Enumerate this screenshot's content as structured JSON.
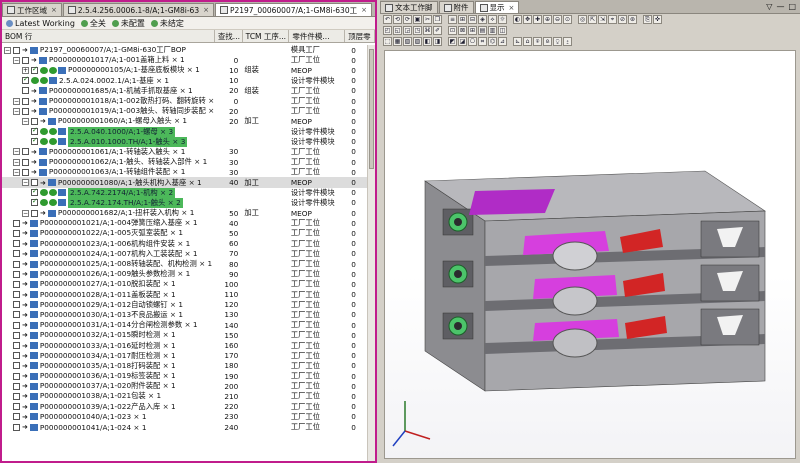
{
  "left_tabs": [
    {
      "label": "工作区域",
      "active": false
    },
    {
      "label": "2.5.4.256.0006.1-8/A;1-GM8i-63",
      "active": false
    },
    {
      "label": "P2197_00060007/A;1-GM8i-630工",
      "active": true
    }
  ],
  "filters": [
    {
      "label": "Latest Working",
      "color": "#6b8fc4"
    },
    {
      "label": "全关",
      "color": "#4f9e4f"
    },
    {
      "label": "未配置",
      "color": "#4f9e4f"
    },
    {
      "label": "未结定",
      "color": "#4f9e4f"
    }
  ],
  "columns": [
    "BOM 行",
    "查找...",
    "TCM 工序...",
    "零件件模...",
    "顶层零"
  ],
  "rows": [
    {
      "depth": 0,
      "exp": "-",
      "name": "P2197_00060007/A;1-GM8i-630工厂BOP",
      "find": "",
      "tcm": "",
      "part": "模具工厂",
      "top": "0",
      "sel": false,
      "hl": false,
      "chk": false
    },
    {
      "depth": 1,
      "exp": "-",
      "name": "P000000001017/A;1-001盖箱上料 × 1",
      "find": "0",
      "tcm": "",
      "part": "工厂工位",
      "top": "0",
      "sel": false,
      "hl": false,
      "chk": false
    },
    {
      "depth": 2,
      "exp": "+",
      "name": "P00000000105/A;1-基座底板模块 × 1",
      "find": "10",
      "tcm": "组装",
      "part": "MEOP",
      "top": "0",
      "sel": false,
      "hl": false,
      "chk": true
    },
    {
      "depth": 2,
      "exp": "",
      "name": "2.5.A.024.0002.1/A;1-基座 × 1",
      "find": "10",
      "tcm": "",
      "part": "设计零件模块",
      "top": "0",
      "sel": false,
      "hl": false,
      "chk": true
    },
    {
      "depth": 2,
      "exp": "",
      "name": "P000000001685/A;1-机械手抓取基座 × 1",
      "find": "20",
      "tcm": "组装",
      "part": "工厂工位",
      "top": "0",
      "sel": false,
      "hl": false,
      "chk": false
    },
    {
      "depth": 1,
      "exp": "-",
      "name": "P000000001018/A;1-002散热打码、翻转旋转 × 1",
      "find": "0",
      "tcm": "",
      "part": "工厂工位",
      "top": "0",
      "sel": false,
      "hl": false,
      "chk": false
    },
    {
      "depth": 1,
      "exp": "-",
      "name": "P000000001019/A;1-003触头、转轴同步装配 × 1",
      "find": "20",
      "tcm": "",
      "part": "工厂工位",
      "top": "0",
      "sel": false,
      "hl": false,
      "chk": false
    },
    {
      "depth": 2,
      "exp": "-",
      "name": "P000000001060/A;1-螺母入触头 × 1",
      "find": "20",
      "tcm": "加工",
      "part": "MEOP",
      "top": "0",
      "sel": false,
      "hl": false,
      "chk": false
    },
    {
      "depth": 3,
      "exp": "",
      "name": "2.5.A.040.1000/A;1-螺母 × 3",
      "find": "",
      "tcm": "",
      "part": "设计零件模块",
      "top": "0",
      "sel": false,
      "hl": true,
      "chk": true
    },
    {
      "depth": 3,
      "exp": "",
      "name": "2.5.A.010.1000.TH/A;1-触头 × 3",
      "find": "",
      "tcm": "",
      "part": "设计零件模块",
      "top": "0",
      "sel": false,
      "hl": true,
      "chk": true
    },
    {
      "depth": 1,
      "exp": "-",
      "name": "P000000001061/A;1-转轴装入触头 × 1",
      "find": "30",
      "tcm": "",
      "part": "工厂工位",
      "top": "0",
      "sel": false,
      "hl": false,
      "chk": false
    },
    {
      "depth": 1,
      "exp": "-",
      "name": "P000000001062/A;1-触头、转轴装入部件 × 1",
      "find": "30",
      "tcm": "",
      "part": "工厂工位",
      "top": "0",
      "sel": false,
      "hl": false,
      "chk": false
    },
    {
      "depth": 1,
      "exp": "-",
      "name": "P000000001063/A;1-转轴组件装配 × 1",
      "find": "30",
      "tcm": "",
      "part": "工厂工位",
      "top": "0",
      "sel": false,
      "hl": false,
      "chk": false
    },
    {
      "depth": 2,
      "exp": "-",
      "name": "P000000001080/A;1-触头机构入基座 × 1",
      "find": "40",
      "tcm": "加工",
      "part": "MEOP",
      "top": "0",
      "sel": true,
      "hl": false,
      "chk": false
    },
    {
      "depth": 3,
      "exp": "",
      "name": "2.5.A.742.2174/A;1-机构 × 2",
      "find": "",
      "tcm": "",
      "part": "设计零件模块",
      "top": "0",
      "sel": false,
      "hl": true,
      "chk": true
    },
    {
      "depth": 3,
      "exp": "",
      "name": "2.5.A.742.174.TH/A;1-触头 × 2",
      "find": "",
      "tcm": "",
      "part": "设计零件模块",
      "top": "0",
      "sel": false,
      "hl": true,
      "chk": true
    },
    {
      "depth": 2,
      "exp": "-",
      "name": "P000000001682/A;1-扭杆装入机构 × 1",
      "find": "50",
      "tcm": "加工",
      "part": "MEOP",
      "top": "0",
      "sel": false,
      "hl": false,
      "chk": false
    },
    {
      "depth": 1,
      "exp": "",
      "name": "P000000001021/A;1-004弹簧压缩入基座 × 1",
      "find": "40",
      "tcm": "",
      "part": "工厂工位",
      "top": "0",
      "sel": false,
      "hl": false,
      "chk": false
    },
    {
      "depth": 1,
      "exp": "",
      "name": "P000000001022/A;1-005灭弧室装配 × 1",
      "find": "50",
      "tcm": "",
      "part": "工厂工位",
      "top": "0",
      "sel": false,
      "hl": false,
      "chk": false
    },
    {
      "depth": 1,
      "exp": "",
      "name": "P000000001023/A;1-006机构组件安装 × 1",
      "find": "60",
      "tcm": "",
      "part": "工厂工位",
      "top": "0",
      "sel": false,
      "hl": false,
      "chk": false
    },
    {
      "depth": 1,
      "exp": "",
      "name": "P000000001024/A;1-007机构入工装装配 × 1",
      "find": "70",
      "tcm": "",
      "part": "工厂工位",
      "top": "0",
      "sel": false,
      "hl": false,
      "chk": false
    },
    {
      "depth": 1,
      "exp": "",
      "name": "P000000001025/A;1-008转轴装配、机构检测 × 1",
      "find": "80",
      "tcm": "",
      "part": "工厂工位",
      "top": "0",
      "sel": false,
      "hl": false,
      "chk": false
    },
    {
      "depth": 1,
      "exp": "",
      "name": "P000000001026/A;1-009触头参数检测 × 1",
      "find": "90",
      "tcm": "",
      "part": "工厂工位",
      "top": "0",
      "sel": false,
      "hl": false,
      "chk": false
    },
    {
      "depth": 1,
      "exp": "",
      "name": "P000000001027/A;1-010脱扣装配 × 1",
      "find": "100",
      "tcm": "",
      "part": "工厂工位",
      "top": "0",
      "sel": false,
      "hl": false,
      "chk": false
    },
    {
      "depth": 1,
      "exp": "",
      "name": "P000000001028/A;1-011盖板装配 × 1",
      "find": "110",
      "tcm": "",
      "part": "工厂工位",
      "top": "0",
      "sel": false,
      "hl": false,
      "chk": false
    },
    {
      "depth": 1,
      "exp": "",
      "name": "P000000001029/A;1-012自动锁螺钉 × 1",
      "find": "120",
      "tcm": "",
      "part": "工厂工位",
      "top": "0",
      "sel": false,
      "hl": false,
      "chk": false
    },
    {
      "depth": 1,
      "exp": "",
      "name": "P000000001030/A;1-013不良品搬运 × 1",
      "find": "130",
      "tcm": "",
      "part": "工厂工位",
      "top": "0",
      "sel": false,
      "hl": false,
      "chk": false
    },
    {
      "depth": 1,
      "exp": "",
      "name": "P000000001031/A;1-014分合闸检测参数 × 1",
      "find": "140",
      "tcm": "",
      "part": "工厂工位",
      "top": "0",
      "sel": false,
      "hl": false,
      "chk": false
    },
    {
      "depth": 1,
      "exp": "",
      "name": "P000000001032/A;1-015瞬时检测 × 1",
      "find": "150",
      "tcm": "",
      "part": "工厂工位",
      "top": "0",
      "sel": false,
      "hl": false,
      "chk": false
    },
    {
      "depth": 1,
      "exp": "",
      "name": "P000000001033/A;1-016延时检测 × 1",
      "find": "160",
      "tcm": "",
      "part": "工厂工位",
      "top": "0",
      "sel": false,
      "hl": false,
      "chk": false
    },
    {
      "depth": 1,
      "exp": "",
      "name": "P000000001034/A;1-017耐压检测 × 1",
      "find": "170",
      "tcm": "",
      "part": "工厂工位",
      "top": "0",
      "sel": false,
      "hl": false,
      "chk": false
    },
    {
      "depth": 1,
      "exp": "",
      "name": "P000000001035/A;1-018打码装配 × 1",
      "find": "180",
      "tcm": "",
      "part": "工厂工位",
      "top": "0",
      "sel": false,
      "hl": false,
      "chk": false
    },
    {
      "depth": 1,
      "exp": "",
      "name": "P000000001036/A;1-019标签装配 × 1",
      "find": "190",
      "tcm": "",
      "part": "工厂工位",
      "top": "0",
      "sel": false,
      "hl": false,
      "chk": false
    },
    {
      "depth": 1,
      "exp": "",
      "name": "P000000001037/A;1-020附件装配 × 1",
      "find": "200",
      "tcm": "",
      "part": "工厂工位",
      "top": "0",
      "sel": false,
      "hl": false,
      "chk": false
    },
    {
      "depth": 1,
      "exp": "",
      "name": "P000000001038/A;1-021包装 × 1",
      "find": "210",
      "tcm": "",
      "part": "工厂工位",
      "top": "0",
      "sel": false,
      "hl": false,
      "chk": false
    },
    {
      "depth": 1,
      "exp": "",
      "name": "P000000001039/A;1-022产品入库 × 1",
      "find": "220",
      "tcm": "",
      "part": "工厂工位",
      "top": "0",
      "sel": false,
      "hl": false,
      "chk": false
    },
    {
      "depth": 1,
      "exp": "",
      "name": "P000000001040/A;1-023 × 1",
      "find": "230",
      "tcm": "",
      "part": "工厂工位",
      "top": "0",
      "sel": false,
      "hl": false,
      "chk": false
    },
    {
      "depth": 1,
      "exp": "",
      "name": "P000000001041/A;1-024 × 1",
      "find": "240",
      "tcm": "",
      "part": "工厂工位",
      "top": "0",
      "sel": false,
      "hl": false,
      "chk": false
    }
  ],
  "right_tabs": [
    {
      "label": "文本工作脚",
      "active": false
    },
    {
      "label": "附件",
      "active": false
    },
    {
      "label": "显示",
      "active": true
    }
  ],
  "window_controls": [
    "▽",
    "—",
    "□"
  ],
  "toolbar1": [
    "↶",
    "⟲",
    "⟳",
    "▣",
    "✂",
    "❐",
    "≡",
    "⊞",
    "⊟",
    "◈",
    "⟡",
    "☼",
    "◐",
    "✥",
    "✚",
    "⊕",
    "⊖",
    "⊙",
    "◎",
    "⇱",
    "⇲",
    "⌖",
    "⊘",
    "⊛",
    "⎘",
    "✜"
  ],
  "toolbar2": [
    "◰",
    "◱",
    "◲",
    "◳",
    "⌘",
    "✐",
    "⊡",
    "⊠",
    "⊞",
    "▤",
    "▥",
    "◫"
  ],
  "toolbar3": [
    "⬚",
    "▦",
    "▧",
    "▨",
    "◧",
    "◨",
    "◩",
    "◪",
    "⎔",
    "⌗",
    "⌬",
    "⊿",
    "⊾",
    "⌂",
    "⍟",
    "⍝",
    "⍜",
    "⍛"
  ]
}
